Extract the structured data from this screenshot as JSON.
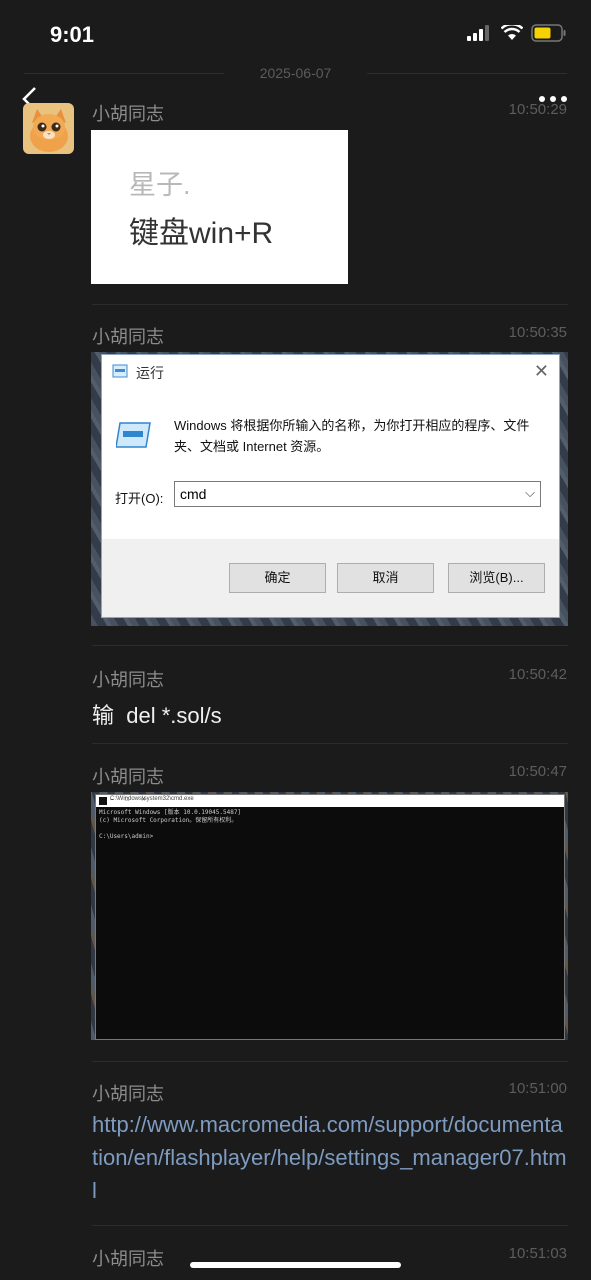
{
  "status": {
    "time": "9:01"
  },
  "header": {
    "date": "2025-06-07"
  },
  "messages": [
    {
      "sender": "小胡同志",
      "time": "10:50:29",
      "image_text": {
        "line1": "星子.",
        "line2": "键盘win+R"
      }
    },
    {
      "sender": "小胡同志",
      "time": "10:50:35",
      "run_dialog": {
        "title": "运行",
        "description": "Windows 将根据你所输入的名称，为你打开相应的程序、文件夹、文档或 Internet 资源。",
        "open_label": "打开(O):",
        "open_value": "cmd",
        "ok": "确定",
        "cancel": "取消",
        "browse": "浏览(B)..."
      }
    },
    {
      "sender": "小胡同志",
      "time": "10:50:42",
      "text": "输  del *.sol/s"
    },
    {
      "sender": "小胡同志",
      "time": "10:50:47",
      "cmd": {
        "title": "C:\\Windows\\system32\\cmd.exe",
        "body": "Microsoft Windows [版本 10.0.19045.5487]\n(c) Microsoft Corporation。保留所有权利。\n\nC:\\Users\\admin>"
      }
    },
    {
      "sender": "小胡同志",
      "time": "10:51:00",
      "link": "http://www.macromedia.com/support/documentation/en/flashplayer/help/settings_manager07.html"
    },
    {
      "sender": "小胡同志",
      "time": "10:51:03",
      "text": ""
    }
  ]
}
